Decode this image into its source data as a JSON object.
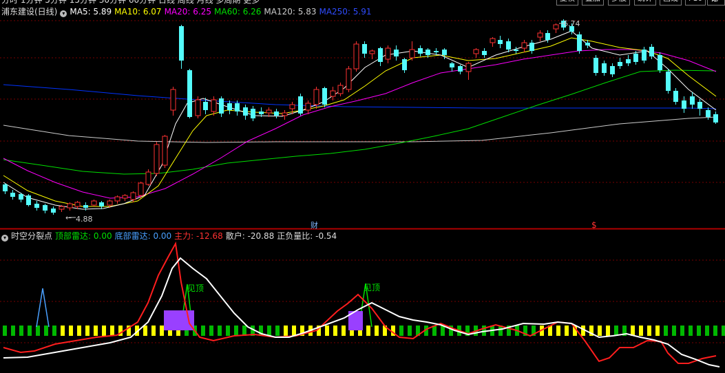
{
  "top_menu": {
    "periods": "分时  1分钟  5分钟  15分钟  30分钟  60分钟  日线  周线  月线  多周期  更多",
    "buttons": [
      "复权",
      "叠加",
      "多股",
      "统计",
      "画线",
      "F10",
      "标记"
    ]
  },
  "main_legend": {
    "stock": "浦东建设(日线)",
    "ma5": "MA5: 5.89",
    "ma10": "MA10: 6.07",
    "ma20": "MA20: 6.25",
    "ma60": "MA60: 6.26",
    "ma120": "MA120: 5.83",
    "ma250": "MA250: 5.91"
  },
  "annotations": {
    "high": "6.74",
    "low": "4.88",
    "cai": "财",
    "dollar": "$"
  },
  "indicator_legend": {
    "name": "时空分裂点",
    "top_radar": "顶部雷达: 0.00",
    "bottom_radar": "底部雷达: 0.00",
    "main_force": "主力: -12.68",
    "retail": "散户: -20.88",
    "ratio": "正负量比: -0.54"
  },
  "signals": {
    "see_top_1": "见顶",
    "see_top_2": "见顶"
  },
  "colors": {
    "up": "#ff3232",
    "down": "#54fcfc",
    "ma5": "#ffffff",
    "ma10": "#ffff00",
    "ma20": "#ff00ff",
    "ma60": "#00e000",
    "ma120": "#cccccc",
    "ma250": "#0033ff"
  }
}
